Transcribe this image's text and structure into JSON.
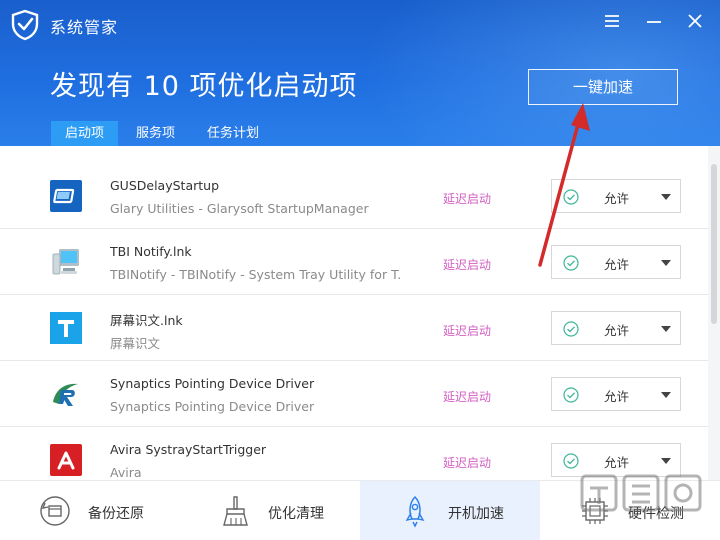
{
  "window": {
    "title": "系统管家",
    "menu_icon": "menu-icon",
    "minimize_icon": "minimize-icon",
    "close_icon": "close-icon"
  },
  "headline": "发现有 10 项优化启动项",
  "speed_button": "一键加速",
  "tabs": [
    {
      "label": "启动项",
      "active": true
    },
    {
      "label": "服务项",
      "active": false
    },
    {
      "label": "任务计划",
      "active": false
    }
  ],
  "items": [
    {
      "name": "GUSDelayStartup",
      "desc": "Glary Utilities - Glarysoft StartupManager",
      "status": "延迟启动",
      "option": "允许",
      "icon": "glary-app-icon"
    },
    {
      "name": "TBI Notify.lnk",
      "desc": "TBINotify - TBINotify - System Tray Utility for T...",
      "status": "延迟启动",
      "option": "允许",
      "icon": "computer-app-icon"
    },
    {
      "name": "屏幕识文.lnk",
      "desc": "屏幕识文",
      "status": "延迟启动",
      "option": "允许",
      "icon": "t-app-icon"
    },
    {
      "name": "Synaptics Pointing Device Driver",
      "desc": "Synaptics Pointing Device Driver",
      "status": "延迟启动",
      "option": "允许",
      "icon": "synaptics-app-icon"
    },
    {
      "name": "Avira SystrayStartTrigger",
      "desc": "Avira",
      "status": "延迟启动",
      "option": "允许",
      "icon": "avira-app-icon"
    }
  ],
  "bottom_nav": [
    {
      "label": "备份还原",
      "icon": "backup-restore-icon",
      "active": false
    },
    {
      "label": "优化清理",
      "icon": "broom-icon",
      "active": false
    },
    {
      "label": "开机加速",
      "icon": "rocket-icon",
      "active": true
    },
    {
      "label": "硬件检测",
      "icon": "chip-icon",
      "active": false
    }
  ],
  "colors": {
    "header": "#1f6ee0",
    "active_tab": "#2c9cf4",
    "status": "#d45fc2",
    "check": "#3fb59a",
    "arrow": "#d32a2a",
    "nav_active": "#e8f1fd"
  }
}
